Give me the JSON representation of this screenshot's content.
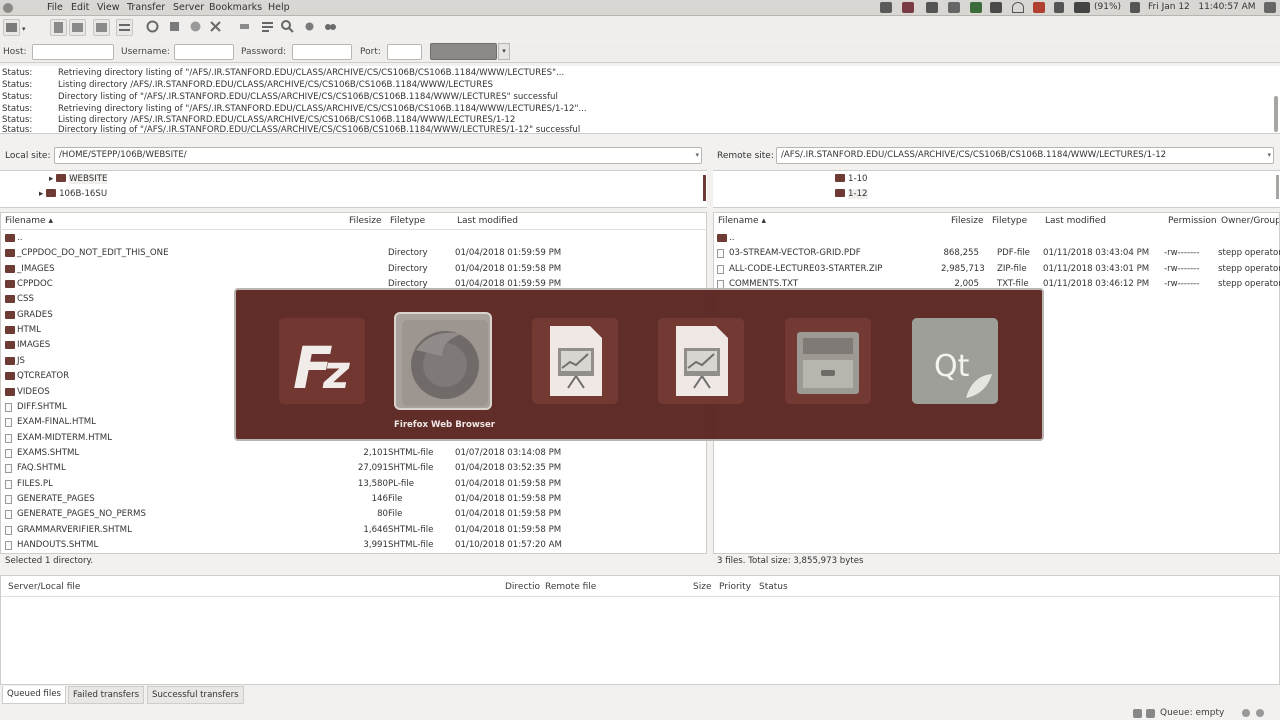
{
  "menubar": {
    "items": [
      "File",
      "Edit",
      "View",
      "Transfer",
      "Server",
      "Bookmarks",
      "Help"
    ],
    "battery": "(91%)",
    "datetime": "Fri Jan 12   11:40:57 AM"
  },
  "quickconnect": {
    "host_label": "Host:",
    "username_label": "Username:",
    "password_label": "Password:",
    "port_label": "Port:",
    "host_value": "",
    "username_value": "",
    "password_value": "",
    "port_value": ""
  },
  "log": [
    {
      "key": "Status:",
      "msg": "Retrieving directory listing of \"/AFS/.IR.STANFORD.EDU/CLASS/ARCHIVE/CS/CS106B/CS106B.1184/WWW/LECTURES\"..."
    },
    {
      "key": "Status:",
      "msg": "Listing directory /AFS/.IR.STANFORD.EDU/CLASS/ARCHIVE/CS/CS106B/CS106B.1184/WWW/LECTURES"
    },
    {
      "key": "Status:",
      "msg": "Directory listing of \"/AFS/.IR.STANFORD.EDU/CLASS/ARCHIVE/CS/CS106B/CS106B.1184/WWW/LECTURES\" successful"
    },
    {
      "key": "Status:",
      "msg": "Retrieving directory listing of \"/AFS/.IR.STANFORD.EDU/CLASS/ARCHIVE/CS/CS106B/CS106B.1184/WWW/LECTURES/1-12\"..."
    },
    {
      "key": "Status:",
      "msg": "Listing directory /AFS/.IR.STANFORD.EDU/CLASS/ARCHIVE/CS/CS106B/CS106B.1184/WWW/LECTURES/1-12"
    },
    {
      "key": "Status:",
      "msg": "Directory listing of \"/AFS/.IR.STANFORD.EDU/CLASS/ARCHIVE/CS/CS106B/CS106B.1184/WWW/LECTURES/1-12\" successful"
    }
  ],
  "local": {
    "label": "Local site:",
    "path": "/HOME/STEPP/106B/WEBSITE/",
    "tree": [
      "WEBSITE",
      "106B-16SU"
    ],
    "headers": {
      "name": "Filename",
      "size": "Filesize",
      "type": "Filetype",
      "modified": "Last modified"
    },
    "files": [
      {
        "name": "..",
        "size": "",
        "type": "",
        "modified": "",
        "folder": true
      },
      {
        "name": "_CPPDOC_DO_NOT_EDIT_THIS_ONE",
        "size": "",
        "type": "Directory",
        "modified": "01/04/2018 01:59:59 PM",
        "folder": true
      },
      {
        "name": "_IMAGES",
        "size": "",
        "type": "Directory",
        "modified": "01/04/2018 01:59:58 PM",
        "folder": true
      },
      {
        "name": "CPPDOC",
        "size": "",
        "type": "Directory",
        "modified": "01/04/2018 01:59:59 PM",
        "folder": true
      },
      {
        "name": "CSS",
        "size": "",
        "type": "",
        "modified": "",
        "folder": true
      },
      {
        "name": "GRADES",
        "size": "",
        "type": "",
        "modified": "",
        "folder": true
      },
      {
        "name": "HTML",
        "size": "",
        "type": "",
        "modified": "",
        "folder": true
      },
      {
        "name": "IMAGES",
        "size": "",
        "type": "",
        "modified": "",
        "folder": true
      },
      {
        "name": "JS",
        "size": "",
        "type": "",
        "modified": "",
        "folder": true
      },
      {
        "name": "QTCREATOR",
        "size": "",
        "type": "",
        "modified": "",
        "folder": true
      },
      {
        "name": "VIDEOS",
        "size": "",
        "type": "",
        "modified": "",
        "folder": true
      },
      {
        "name": "DIFF.SHTML",
        "size": "",
        "type": "",
        "modified": "",
        "folder": false
      },
      {
        "name": "EXAM-FINAL.HTML",
        "size": "",
        "type": "",
        "modified": "",
        "folder": false
      },
      {
        "name": "EXAM-MIDTERM.HTML",
        "size": "",
        "type": "",
        "modified": "",
        "folder": false
      },
      {
        "name": "EXAMS.SHTML",
        "size": "2,101",
        "type": "SHTML-file",
        "modified": "01/07/2018 03:14:08 PM",
        "folder": false
      },
      {
        "name": "FAQ.SHTML",
        "size": "27,091",
        "type": "SHTML-file",
        "modified": "01/04/2018 03:52:35 PM",
        "folder": false
      },
      {
        "name": "FILES.PL",
        "size": "13,580",
        "type": "PL-file",
        "modified": "01/04/2018 01:59:58 PM",
        "folder": false
      },
      {
        "name": "GENERATE_PAGES",
        "size": "146",
        "type": "File",
        "modified": "01/04/2018 01:59:58 PM",
        "folder": false
      },
      {
        "name": "GENERATE_PAGES_NO_PERMS",
        "size": "80",
        "type": "File",
        "modified": "01/04/2018 01:59:58 PM",
        "folder": false
      },
      {
        "name": "GRAMMARVERIFIER.SHTML",
        "size": "1,646",
        "type": "SHTML-file",
        "modified": "01/04/2018 01:59:58 PM",
        "folder": false
      },
      {
        "name": "HANDOUTS.SHTML",
        "size": "3,991",
        "type": "SHTML-file",
        "modified": "01/10/2018 01:57:20 AM",
        "folder": false
      }
    ],
    "status": "Selected 1 directory."
  },
  "remote": {
    "label": "Remote site:",
    "path": "/AFS/.IR.STANFORD.EDU/CLASS/ARCHIVE/CS/CS106B/CS106B.1184/WWW/LECTURES/1-12",
    "tree": [
      "1-10",
      "1-12"
    ],
    "headers": {
      "name": "Filename",
      "size": "Filesize",
      "type": "Filetype",
      "modified": "Last modified",
      "perm": "Permission",
      "owner": "Owner/Group"
    },
    "files": [
      {
        "name": "..",
        "size": "",
        "type": "",
        "modified": "",
        "perm": "",
        "owner": "",
        "folder": true
      },
      {
        "name": "03-STREAM-VECTOR-GRID.PDF",
        "size": "868,255",
        "type": "PDF-file",
        "modified": "01/11/2018 03:43:04 PM",
        "perm": "-rw-------",
        "owner": "stepp operator",
        "folder": false
      },
      {
        "name": "ALL-CODE-LECTURE03-STARTER.ZIP",
        "size": "2,985,713",
        "type": "ZIP-file",
        "modified": "01/11/2018 03:43:01 PM",
        "perm": "-rw-------",
        "owner": "stepp operator",
        "folder": false
      },
      {
        "name": "COMMENTS.TXT",
        "size": "2,005",
        "type": "TXT-file",
        "modified": "01/11/2018 03:46:12 PM",
        "perm": "-rw-------",
        "owner": "stepp operator",
        "folder": false
      }
    ],
    "status": "3 files. Total size: 3,855,973 bytes"
  },
  "queue": {
    "headers": [
      "Server/Local file",
      "Directio",
      "Remote file",
      "Size",
      "Priority",
      "Status"
    ],
    "tabs": [
      "Queued files",
      "Failed transfers",
      "Successful transfers"
    ],
    "status": "Queue: empty"
  },
  "switcher": {
    "apps": [
      "filezilla",
      "firefox",
      "impress-1",
      "impress-2",
      "file-manager",
      "qt-creator"
    ],
    "selected_label": "Firefox Web Browser"
  }
}
